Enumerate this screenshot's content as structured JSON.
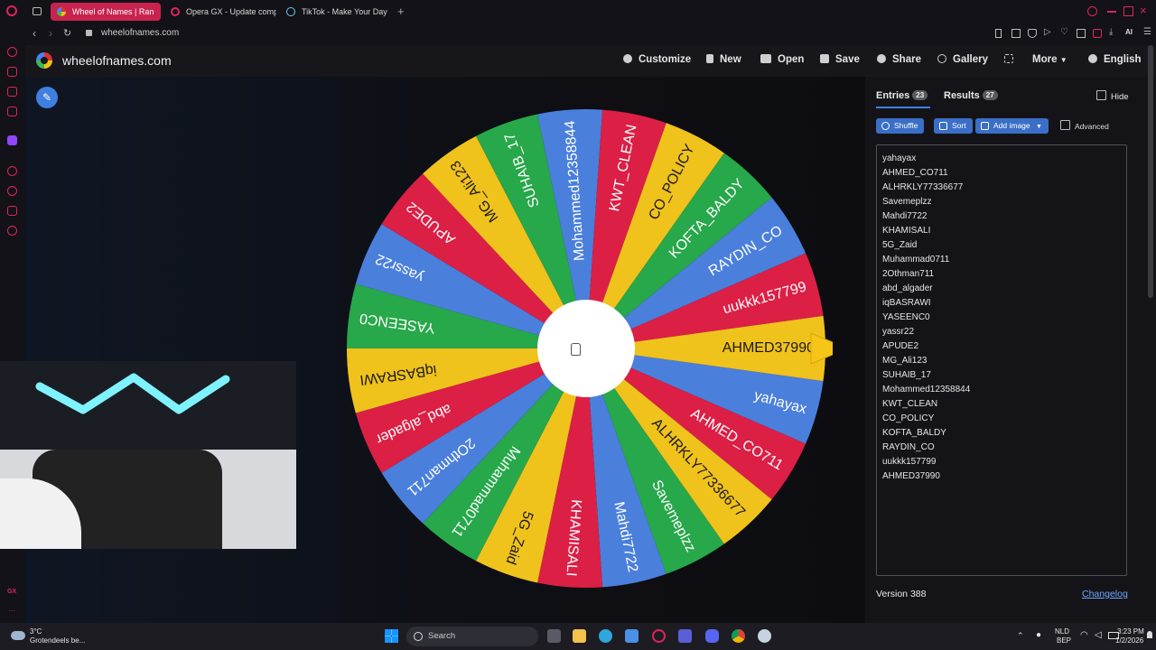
{
  "browser": {
    "tabs": [
      {
        "label": "Wheel of Names | Ran",
        "active": true
      },
      {
        "label": "Opera GX - Update comp",
        "active": false
      },
      {
        "label": "TikTok - Make Your Day",
        "active": false
      }
    ],
    "url": "wheelofnames.com",
    "accent": "#e0245e"
  },
  "site": {
    "name": "wheelofnames.com",
    "nav": [
      "Customize",
      "New",
      "Open",
      "Save",
      "Share",
      "Gallery",
      "More",
      "English"
    ]
  },
  "panel": {
    "tab_entries": "Entries",
    "entries_count": "23",
    "tab_results": "Results",
    "results_count": "27",
    "hide_label": "Hide",
    "shuffle": "Shuffle",
    "sort": "Sort",
    "add_image": "Add image",
    "advanced": "Advanced",
    "entries": [
      "yahayax",
      "AHMED_CO711",
      "ALHRKLY77336677",
      "Savemeplzz",
      "Mahdi7722",
      "KHAMISALI",
      "5G_Zaid",
      "Muhammad0711",
      "2Othman711",
      "abd_algader",
      "iqBASRAWI",
      "YASEENC0",
      "yassr22",
      "APUDE2",
      "MG_Ali123",
      "SUHAIB_17",
      "Mohammed12358844",
      "KWT_CLEAN",
      "CO_POLICY",
      "KOFTA_BALDY",
      "RAYDIN_CO",
      "uukkk157799",
      "AHMED37990"
    ],
    "version": "Version 388",
    "changelog": "Changelog"
  },
  "wheel": {
    "colors": [
      "#4a7fdc",
      "#dc1f45",
      "#f0c21c",
      "#27a84a"
    ],
    "pointer_color": "#f5c518"
  },
  "taskbar": {
    "weather_temp": "3°C",
    "weather_desc": "Grotendeels be...",
    "search": "Search",
    "lang": "NLD",
    "lang2": "BEP",
    "time": "3:23 PM",
    "date": "1/2/2026"
  }
}
